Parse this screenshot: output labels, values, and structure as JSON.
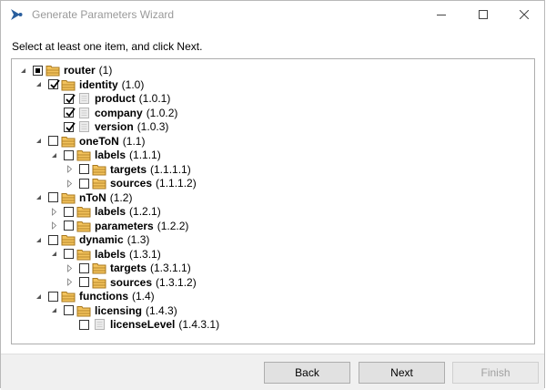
{
  "window": {
    "title": "Generate Parameters Wizard"
  },
  "instruction": "Select at least one item, and click Next.",
  "tree": [
    {
      "label": "router",
      "id": "(1)",
      "level": 0,
      "expander": "expanded",
      "check": "partial",
      "icon": "folder"
    },
    {
      "label": "identity",
      "id": "(1.0)",
      "level": 1,
      "expander": "expanded",
      "check": "checked",
      "icon": "folder"
    },
    {
      "label": "product",
      "id": "(1.0.1)",
      "level": 2,
      "expander": "none",
      "check": "checked",
      "icon": "parameter"
    },
    {
      "label": "company",
      "id": "(1.0.2)",
      "level": 2,
      "expander": "none",
      "check": "checked",
      "icon": "parameter"
    },
    {
      "label": "version",
      "id": "(1.0.3)",
      "level": 2,
      "expander": "none",
      "check": "checked",
      "icon": "parameter"
    },
    {
      "label": "oneToN",
      "id": "(1.1)",
      "level": 1,
      "expander": "expanded",
      "check": "unchecked",
      "icon": "folder"
    },
    {
      "label": "labels",
      "id": "(1.1.1)",
      "level": 2,
      "expander": "expanded",
      "check": "unchecked",
      "icon": "folder"
    },
    {
      "label": "targets",
      "id": "(1.1.1.1)",
      "level": 3,
      "expander": "collapsed",
      "check": "unchecked",
      "icon": "folder"
    },
    {
      "label": "sources",
      "id": "(1.1.1.2)",
      "level": 3,
      "expander": "collapsed",
      "check": "unchecked",
      "icon": "folder"
    },
    {
      "label": "nToN",
      "id": "(1.2)",
      "level": 1,
      "expander": "expanded",
      "check": "unchecked",
      "icon": "folder"
    },
    {
      "label": "labels",
      "id": "(1.2.1)",
      "level": 2,
      "expander": "collapsed",
      "check": "unchecked",
      "icon": "folder"
    },
    {
      "label": "parameters",
      "id": "(1.2.2)",
      "level": 2,
      "expander": "collapsed",
      "check": "unchecked",
      "icon": "folder"
    },
    {
      "label": "dynamic",
      "id": "(1.3)",
      "level": 1,
      "expander": "expanded",
      "check": "unchecked",
      "icon": "folder"
    },
    {
      "label": "labels",
      "id": "(1.3.1)",
      "level": 2,
      "expander": "expanded",
      "check": "unchecked",
      "icon": "folder"
    },
    {
      "label": "targets",
      "id": "(1.3.1.1)",
      "level": 3,
      "expander": "collapsed",
      "check": "unchecked",
      "icon": "folder"
    },
    {
      "label": "sources",
      "id": "(1.3.1.2)",
      "level": 3,
      "expander": "collapsed",
      "check": "unchecked",
      "icon": "folder"
    },
    {
      "label": "functions",
      "id": "(1.4)",
      "level": 1,
      "expander": "expanded",
      "check": "unchecked",
      "icon": "folder"
    },
    {
      "label": "licensing",
      "id": "(1.4.3)",
      "level": 2,
      "expander": "expanded",
      "check": "unchecked",
      "icon": "folder"
    },
    {
      "label": "licenseLevel",
      "id": "(1.4.3.1)",
      "level": 3,
      "expander": "none",
      "check": "unchecked",
      "icon": "parameter"
    }
  ],
  "buttons": {
    "back": "Back",
    "next": "Next",
    "finish": "Finish"
  },
  "colors": {
    "folder_fill": "#f2c25c",
    "folder_stroke": "#a8781e",
    "param_fill": "#ececec",
    "app_icon": "#2a5f9e"
  }
}
